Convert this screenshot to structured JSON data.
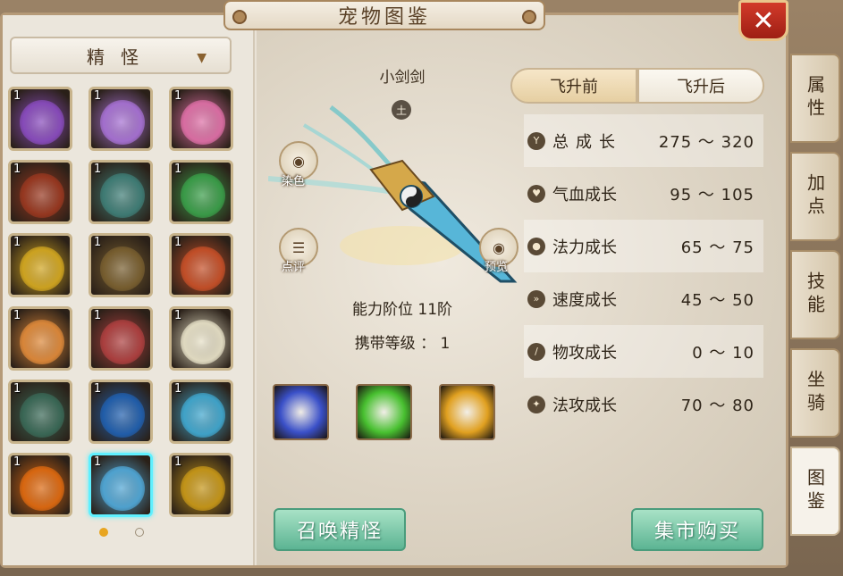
{
  "window": {
    "title": "宠物图鉴",
    "close_label": "✕"
  },
  "category_dropdown": {
    "selected": "精怪",
    "arrow": "▼"
  },
  "pet_grid": [
    {
      "level": "1",
      "name": "sword-pet-purple",
      "color": "#8a4cc0"
    },
    {
      "level": "1",
      "name": "tiger-purple",
      "color": "#a872d6"
    },
    {
      "level": "1",
      "name": "deer-pink",
      "color": "#e070a8"
    },
    {
      "level": "1",
      "name": "gourd-red",
      "color": "#9a3820"
    },
    {
      "level": "1",
      "name": "sword-pet-teal",
      "color": "#3f7f78"
    },
    {
      "level": "1",
      "name": "tiger-green",
      "color": "#3aa04a"
    },
    {
      "level": "1",
      "name": "gourd-gold",
      "color": "#d4a820"
    },
    {
      "level": "1",
      "name": "beast-gold",
      "color": "#7a6030"
    },
    {
      "level": "1",
      "name": "sword-pet-red",
      "color": "#c85028"
    },
    {
      "level": "1",
      "name": "deer-orange",
      "color": "#e08a3a"
    },
    {
      "level": "1",
      "name": "lion-red",
      "color": "#b04040"
    },
    {
      "level": "1",
      "name": "cloud-white",
      "color": "#e8e2c8"
    },
    {
      "level": "1",
      "name": "beast-jade",
      "color": "#3a6a58"
    },
    {
      "level": "1",
      "name": "dragon-blue",
      "color": "#2060b0"
    },
    {
      "level": "1",
      "name": "dragon-cyan",
      "color": "#40a8d0"
    },
    {
      "level": "1",
      "name": "fire-phoenix",
      "color": "#e06a10"
    },
    {
      "level": "1",
      "name": "sword-pet-blue",
      "color": "#50a8d8",
      "selected": true
    },
    {
      "level": "1",
      "name": "lion-gold",
      "color": "#c89818"
    }
  ],
  "pager": {
    "pages": 2,
    "current": 1
  },
  "pet_detail": {
    "name": "小剑剑",
    "element": "土",
    "dye_label": "染色",
    "comment_label": "点评",
    "preview_label": "预览",
    "ability_rank": "能力阶位 11阶",
    "carry_level": "携带等级 ： 1"
  },
  "skills": [
    {
      "name": "skill-lightning-hand",
      "color": "#3a50c8"
    },
    {
      "name": "skill-green-skull",
      "color": "#48c030"
    },
    {
      "name": "skill-golden-burst",
      "color": "#e0a020"
    }
  ],
  "ascension_tabs": {
    "before": "飞升前",
    "after": "飞升后",
    "active": "before"
  },
  "stats": [
    {
      "icon": "Y",
      "label": "总成长",
      "spaced": true,
      "value": "275 ～ 320"
    },
    {
      "icon": "♥",
      "label": "气血成长",
      "value": "95 ～ 105"
    },
    {
      "icon": "●",
      "label": "法力成长",
      "value": "65 ～ 75"
    },
    {
      "icon": "»",
      "label": "速度成长",
      "value": "45 ～ 50"
    },
    {
      "icon": "/",
      "label": "物攻成长",
      "value": "0 ～ 10"
    },
    {
      "icon": "✦",
      "label": "法攻成长",
      "value": "70 ～ 80"
    }
  ],
  "actions": {
    "summon": "召唤精怪",
    "market": "集市购买"
  },
  "side_tabs": [
    {
      "label": "属性",
      "active": false
    },
    {
      "label": "加点",
      "active": false
    },
    {
      "label": "技能",
      "active": false
    },
    {
      "label": "坐骑",
      "active": false
    },
    {
      "label": "图鉴",
      "active": true
    }
  ]
}
